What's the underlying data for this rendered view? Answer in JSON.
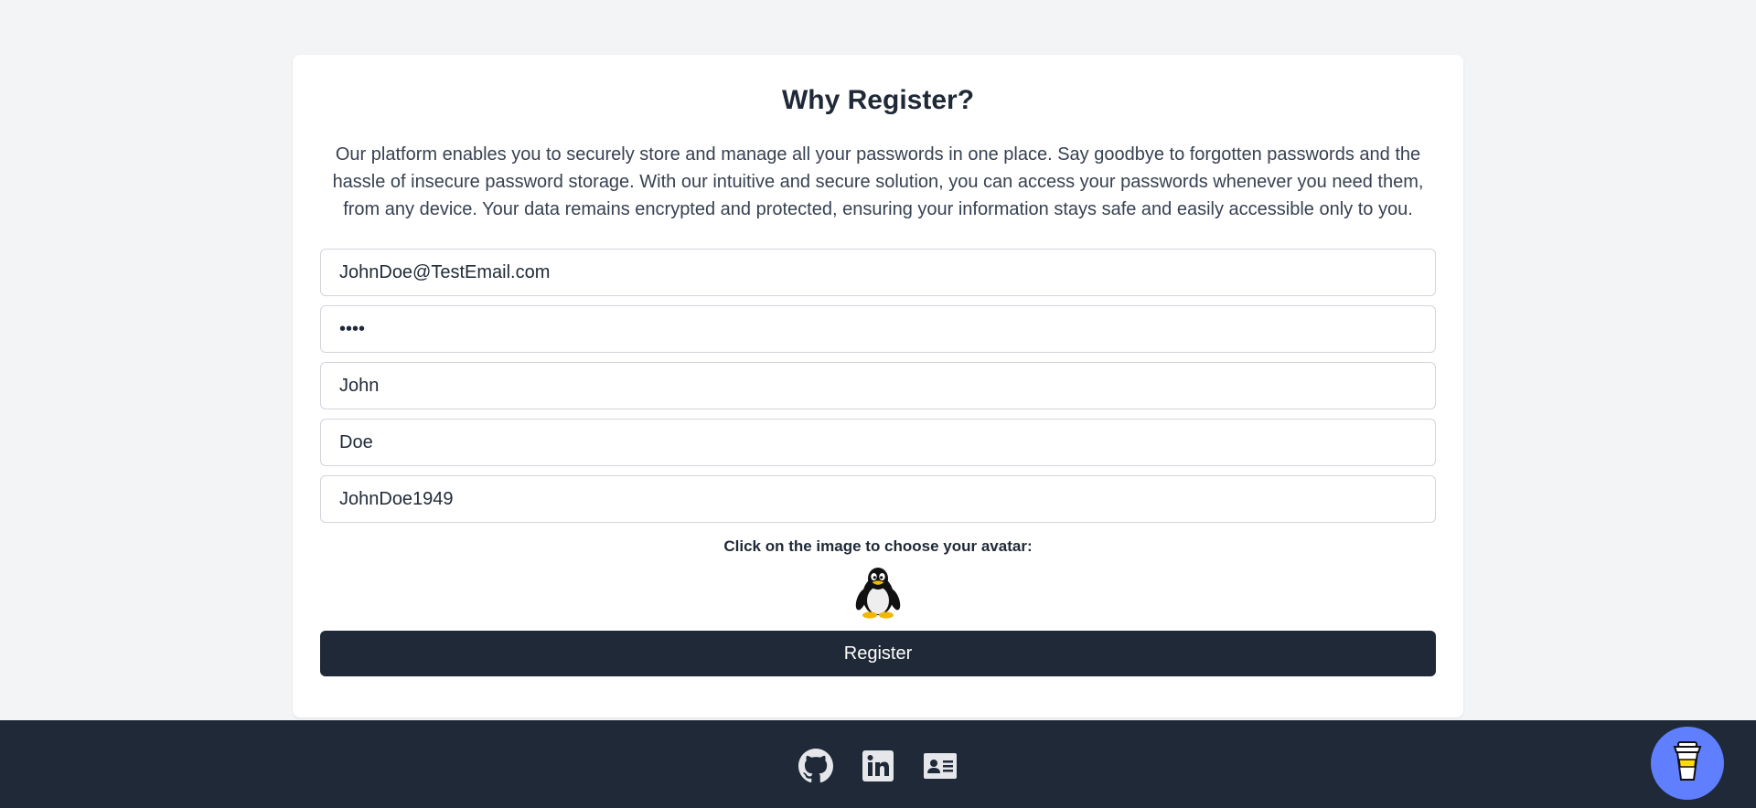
{
  "register": {
    "title": "Why Register?",
    "description": "Our platform enables you to securely store and manage all your passwords in one place. Say goodbye to forgotten passwords and the hassle of insecure password storage. With our intuitive and secure solution, you can access your passwords whenever you need them, from any device. Your data remains encrypted and protected, ensuring your information stays safe and easily accessible only to you.",
    "fields": {
      "email": "JohnDoe@TestEmail.com",
      "password": "1234",
      "first_name": "John",
      "last_name": "Doe",
      "username": "JohnDoe1949"
    },
    "avatar_label": "Click on the image to choose your avatar:",
    "avatar_icon": "penguin-icon",
    "button_label": "Register"
  },
  "footer": {
    "icons": [
      "github-icon",
      "linkedin-icon",
      "contact-card-icon"
    ],
    "coffee_icon": "coffee-cup-icon"
  },
  "colors": {
    "background": "#f3f4f6",
    "card": "#ffffff",
    "dark": "#1f2937",
    "coffee_button": "#5f7fff"
  }
}
